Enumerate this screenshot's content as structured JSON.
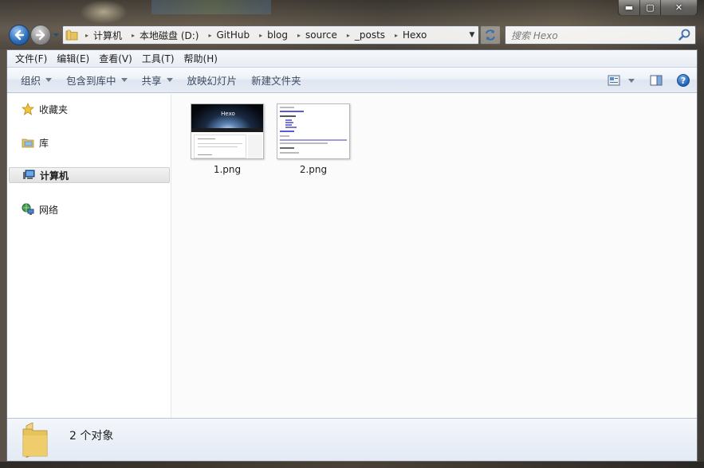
{
  "window": {
    "caption": {
      "minimize": "▬",
      "maximize": "▢",
      "close": "✕"
    }
  },
  "address": {
    "crumbs": [
      "计算机",
      "本地磁盘 (D:)",
      "GitHub",
      "blog",
      "source",
      "_posts",
      "Hexo"
    ]
  },
  "search": {
    "placeholder": "搜索 Hexo"
  },
  "menu": {
    "items": [
      "文件(F)",
      "编辑(E)",
      "查看(V)",
      "工具(T)",
      "帮助(H)"
    ]
  },
  "commands": {
    "organize": "组织",
    "include_in_library": "包含到库中",
    "share": "共享",
    "slideshow": "放映幻灯片",
    "new_folder": "新建文件夹",
    "help": "?"
  },
  "navigation": {
    "favorites": "收藏夹",
    "libraries": "库",
    "computer": "计算机",
    "network": "网络"
  },
  "files": [
    {
      "name": "1.png",
      "thumb_title": "Hexo"
    },
    {
      "name": "2.png"
    }
  ],
  "status": {
    "text": "2 个对象"
  },
  "colors": {
    "accent": "#2a6bb8",
    "folder": "#e8c25a"
  }
}
